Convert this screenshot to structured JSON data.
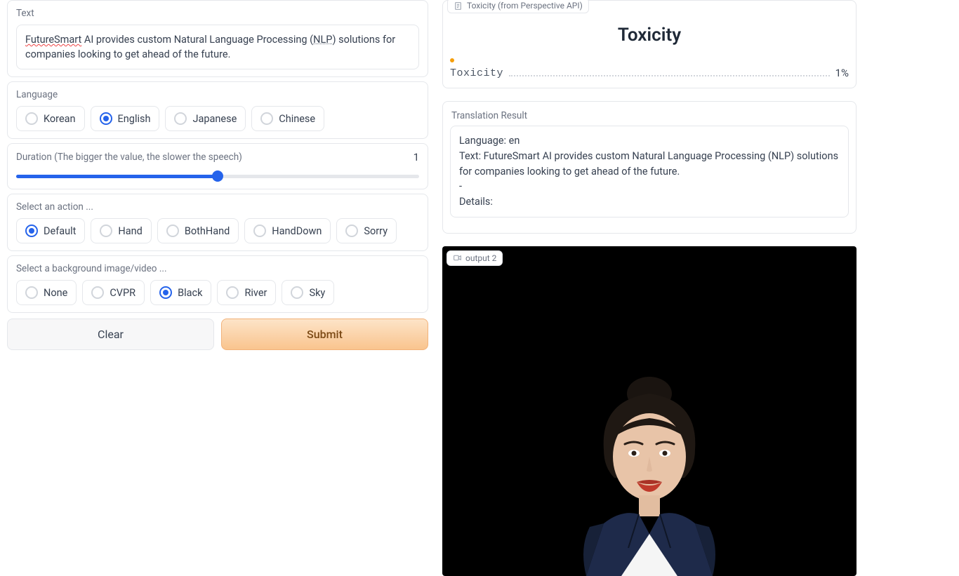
{
  "left": {
    "text_label": "Text",
    "text_value": "FutureSmart AI provides custom Natural Language Processing (NLP) solutions for companies looking to get ahead of the future.",
    "language_label": "Language",
    "language_options": [
      "Korean",
      "English",
      "Japanese",
      "Chinese"
    ],
    "language_selected": "English",
    "duration_label": "Duration (The bigger the value, the slower the speech)",
    "duration_value": "1",
    "duration_fill_pct": 50,
    "action_label": "Select an action ...",
    "action_options": [
      "Default",
      "Hand",
      "BothHand",
      "HandDown",
      "Sorry"
    ],
    "action_selected": "Default",
    "bg_label": "Select a background image/video ...",
    "bg_options": [
      "None",
      "CVPR",
      "Black",
      "River",
      "Sky"
    ],
    "bg_selected": "Black",
    "clear_label": "Clear",
    "submit_label": "Submit"
  },
  "right": {
    "toxicity_header": "Toxicity (from Perspective API)",
    "toxicity_title": "Toxicity",
    "toxicity_row_label": "Toxicity",
    "toxicity_pct": "1%",
    "translation_label": "Translation Result",
    "translation_lines": {
      "lang": "Language: en",
      "text": "Text: FutureSmart AI provides custom Natural Language Processing (NLP) solutions for companies looking to get ahead of the future.",
      "dash": "-",
      "details": "Details:"
    },
    "output_tag": "output 2"
  }
}
